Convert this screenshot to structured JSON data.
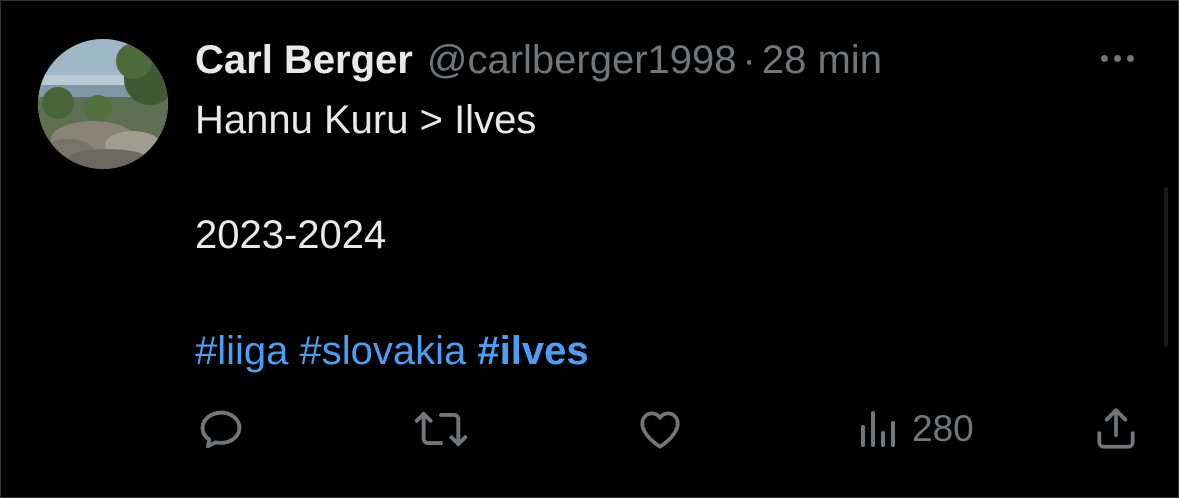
{
  "tweet": {
    "author_name": "Carl Berger",
    "handle": "@carlberger1998",
    "separator": "·",
    "time": "28 min",
    "text_line_1": "Hannu Kuru > Ilves",
    "text_line_2": "2023-2024",
    "hashtags": [
      "#liiga",
      "#slovakia",
      "#ilves"
    ]
  },
  "actions": {
    "views_count": "280"
  },
  "icons": {
    "avatar": "avatar-landscape-photo",
    "more": "more-icon",
    "reply": "reply-icon",
    "retweet": "retweet-icon",
    "like": "heart-icon",
    "views": "views-icon",
    "share": "share-icon"
  },
  "colors": {
    "background": "#000000",
    "text": "#e7e9ea",
    "secondary": "#71767b",
    "hashtag": "#4a9ff5"
  }
}
